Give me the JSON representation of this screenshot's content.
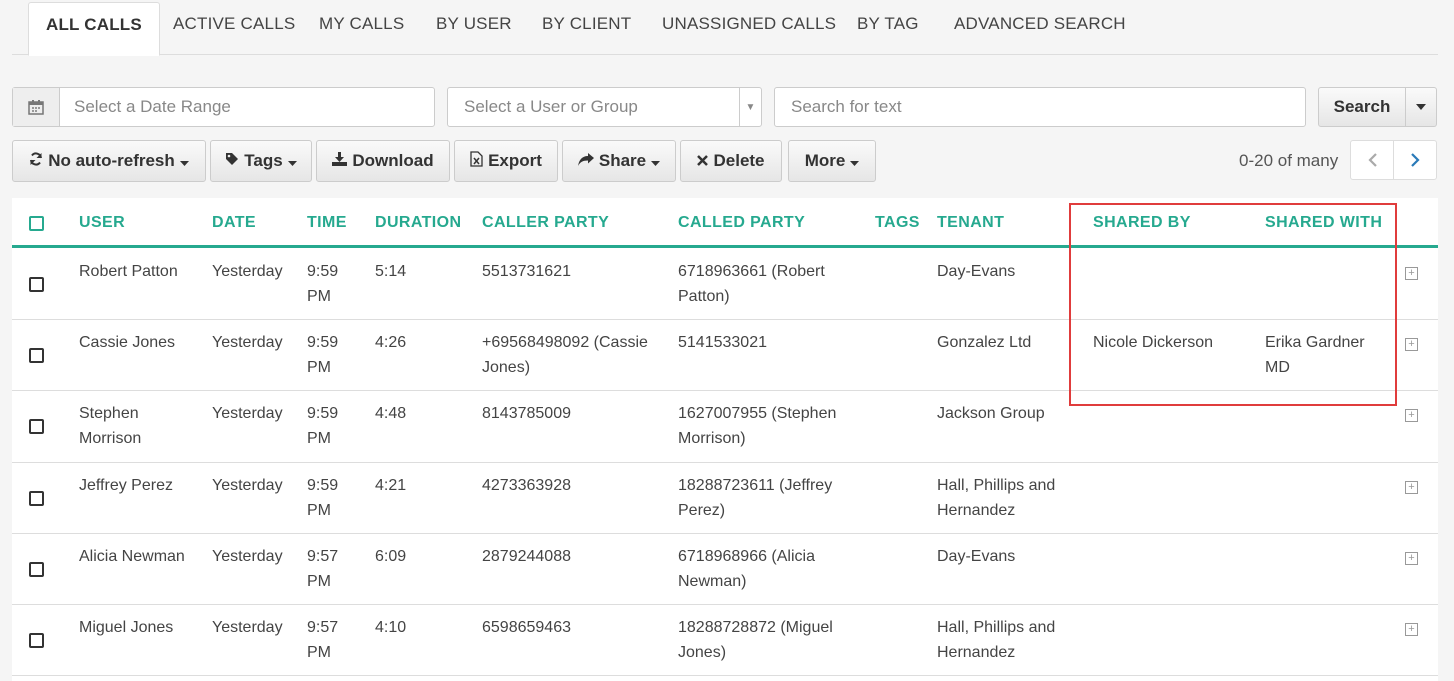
{
  "tabs": [
    {
      "label": "ALL CALLS",
      "active": true
    },
    {
      "label": "ACTIVE CALLS"
    },
    {
      "label": "MY CALLS"
    },
    {
      "label": "BY USER"
    },
    {
      "label": "BY CLIENT"
    },
    {
      "label": "UNASSIGNED CALLS"
    },
    {
      "label": "BY TAG"
    },
    {
      "label": "ADVANCED SEARCH"
    }
  ],
  "filters": {
    "date_placeholder": "Select a Date Range",
    "user_placeholder": "Select a User or Group",
    "text_placeholder": "Search for text",
    "search_label": "Search"
  },
  "toolbar": {
    "refresh_label": "No auto-refresh",
    "tags_label": "Tags",
    "download_label": "Download",
    "export_label": "Export",
    "share_label": "Share",
    "delete_label": "Delete",
    "more_label": "More"
  },
  "pager": {
    "text": "0-20 of many"
  },
  "columns": {
    "user": "USER",
    "date": "DATE",
    "time": "TIME",
    "duration": "DURATION",
    "caller": "CALLER PARTY",
    "called": "CALLED PARTY",
    "tags": "TAGS",
    "tenant": "TENANT",
    "shared_by": "SHARED BY",
    "shared_with": "SHARED WITH"
  },
  "rows": [
    {
      "user": "Robert Patton",
      "date": "Yesterday",
      "time": "9:59 PM",
      "duration": "5:14",
      "caller": "5513731621",
      "called": "6718963661 (Robert Patton)",
      "tenant": "Day-Evans",
      "shared_by": "",
      "shared_with": ""
    },
    {
      "user": "Cassie Jones",
      "date": "Yesterday",
      "time": "9:59 PM",
      "duration": "4:26",
      "caller": "+69568498092 (Cassie Jones)",
      "called": "5141533021",
      "tenant": "Gonzalez Ltd",
      "shared_by": "Nicole Dickerson",
      "shared_with": "Erika Gardner MD"
    },
    {
      "user": "Stephen Morrison",
      "date": "Yesterday",
      "time": "9:59 PM",
      "duration": "4:48",
      "caller": "8143785009",
      "called": "1627007955 (Stephen Morrison)",
      "tenant": "Jackson Group",
      "shared_by": "",
      "shared_with": ""
    },
    {
      "user": "Jeffrey Perez",
      "date": "Yesterday",
      "time": "9:59 PM",
      "duration": "4:21",
      "caller": "4273363928",
      "called": "18288723611 (Jeffrey Perez)",
      "tenant": "Hall, Phillips and Hernandez",
      "shared_by": "",
      "shared_with": ""
    },
    {
      "user": "Alicia Newman",
      "date": "Yesterday",
      "time": "9:57 PM",
      "duration": "6:09",
      "caller": "2879244088",
      "called": "6718968966 (Alicia Newman)",
      "tenant": "Day-Evans",
      "shared_by": "",
      "shared_with": ""
    },
    {
      "user": "Miguel Jones",
      "date": "Yesterday",
      "time": "9:57 PM",
      "duration": "4:10",
      "caller": "6598659463",
      "called": "18288728872 (Miguel Jones)",
      "tenant": "Hall, Phillips and Hernandez",
      "shared_by": "",
      "shared_with": ""
    }
  ],
  "colors": {
    "accent": "#26a98f",
    "highlight": "#e03c3c"
  }
}
